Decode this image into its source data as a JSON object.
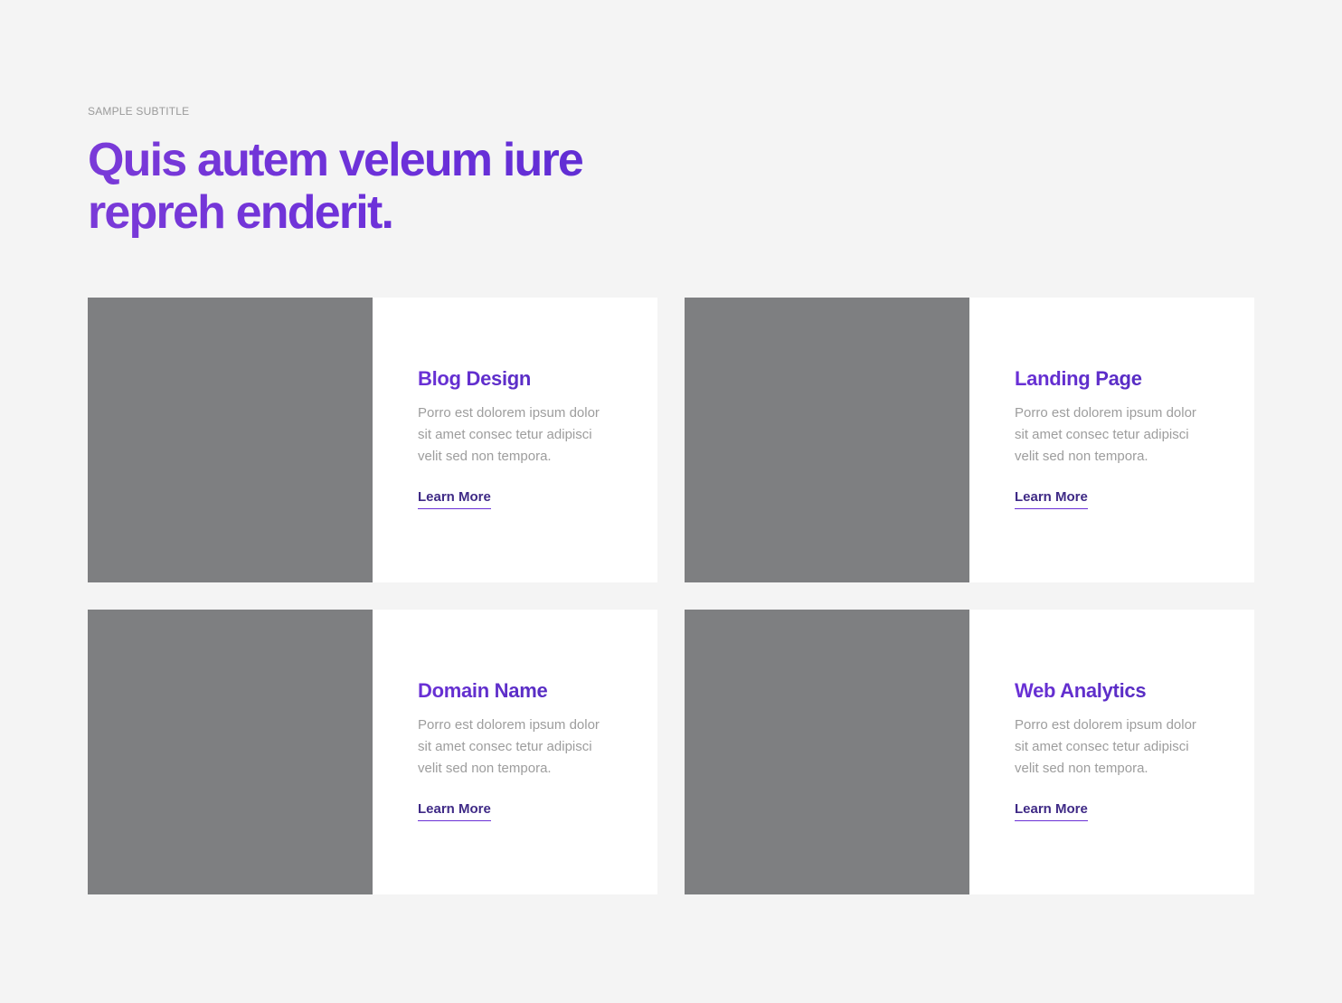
{
  "section": {
    "subtitle": "SAMPLE SUBTITLE",
    "title": "Quis autem veleum iure repreh enderit."
  },
  "cards": [
    {
      "title": "Blog Design",
      "text": "Porro est dolorem ipsum dolor sit amet consec tetur adipisci velit sed non tempora.",
      "link": "Learn More"
    },
    {
      "title": "Landing Page",
      "text": "Porro est dolorem ipsum dolor sit amet consec tetur adipisci velit sed non tempora.",
      "link": "Learn More"
    },
    {
      "title": "Domain Name",
      "text": "Porro est dolorem ipsum dolor sit amet consec tetur adipisci velit sed non tempora.",
      "link": "Learn More"
    },
    {
      "title": "Web Analytics",
      "text": "Porro est dolorem ipsum dolor sit amet consec tetur adipisci velit sed non tempora.",
      "link": "Learn More"
    }
  ],
  "colors": {
    "accent": "#6d31d9",
    "link": "#3f2a86",
    "image_placeholder": "#7e7f81",
    "background": "#f4f4f4"
  }
}
